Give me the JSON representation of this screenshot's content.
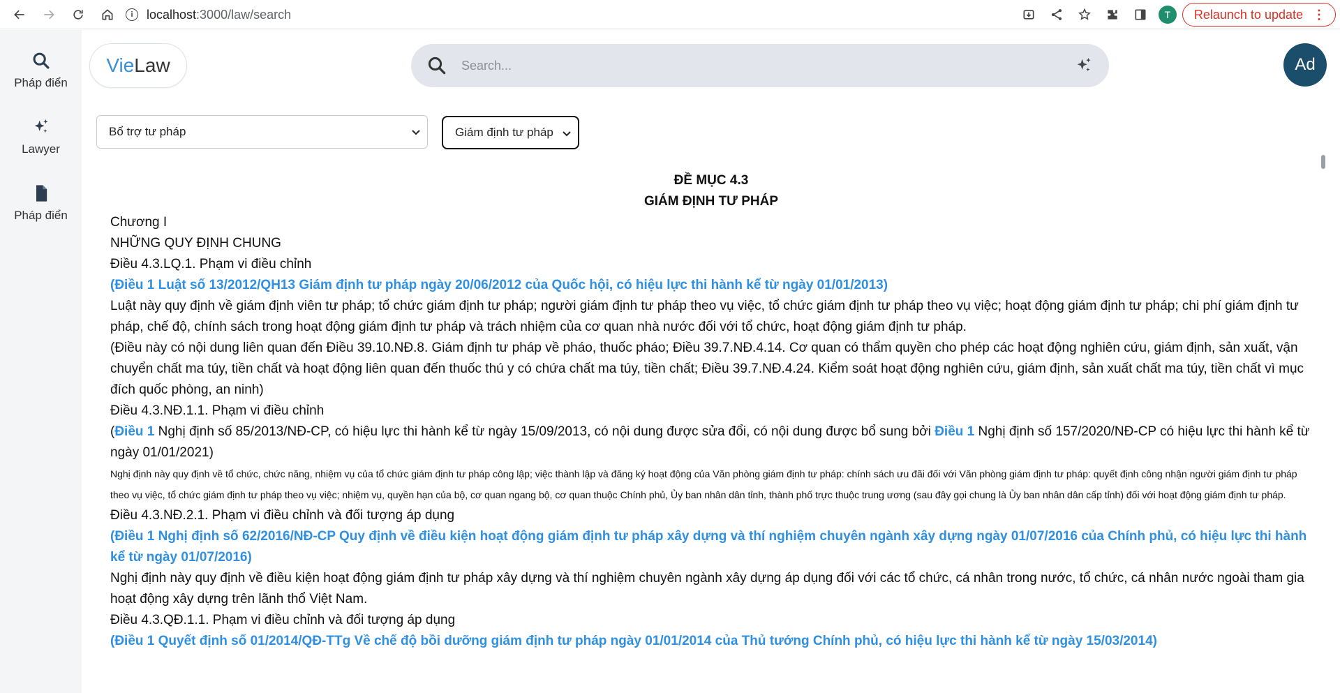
{
  "browser": {
    "url_host": "localhost",
    "url_path": ":3000/law/search",
    "profile_initial": "T",
    "relaunch_label": "Relaunch to update",
    "relaunch_menu": "⋮"
  },
  "sidebar": {
    "items": [
      {
        "label": "Pháp điển",
        "icon": "search-icon"
      },
      {
        "label": "Lawyer",
        "icon": "sparkle-icon"
      },
      {
        "label": "Pháp điển",
        "icon": "document-icon"
      }
    ]
  },
  "header": {
    "logo_vie": "Vie",
    "logo_law": "Law",
    "search_placeholder": "Search...",
    "avatar_initials": "Ad"
  },
  "filters": {
    "topic_selected": "Bổ trợ tư pháp",
    "section_selected": "Giám định tư pháp"
  },
  "document": {
    "heading_1": "ĐỀ MỤC 4.3",
    "heading_2": "GIÁM ĐỊNH TƯ PHÁP",
    "chapter": "Chương I",
    "chapter_title": "NHỮNG QUY ĐỊNH CHUNG",
    "art1_title": "Điều 4.3.LQ.1. Phạm vi điều chỉnh",
    "art1_source": "(Điều 1 Luật số 13/2012/QH13 Giám định tư pháp ngày 20/06/2012 của Quốc hội, có hiệu lực thi hành kể từ ngày 01/01/2013)",
    "art1_body": "Luật này quy định về giám định viên tư pháp; tổ chức giám định tư pháp; người giám định tư pháp theo vụ việc, tổ chức giám định tư pháp theo vụ việc; hoạt động giám định tư pháp; chi phí giám định tư pháp, chế độ, chính sách trong hoạt động giám định tư pháp và trách nhiệm của cơ quan nhà nước đối với tổ chức, hoạt động giám định tư pháp.",
    "art1_related": "(Điều này có nội dung liên quan đến Điều 39.10.NĐ.8. Giám định tư pháp về pháo, thuốc pháo; Điều 39.7.NĐ.4.14. Cơ quan có thẩm quyền cho phép các hoạt động nghiên cứu, giám định, sản xuất, vận chuyển chất ma túy, tiền chất và hoạt động liên quan đến thuốc thú y có chứa chất ma túy, tiền chất; Điều 39.7.NĐ.4.24. Kiểm soát hoạt động nghiên cứu, giám định, sản xuất chất ma túy, tiền chất vì mục đích quốc phòng, an ninh)",
    "art2_title": "Điều 4.3.NĐ.1.1. Phạm vi điều chỉnh",
    "art2_src_open": "(",
    "art2_src_link1": "Điều 1",
    "art2_src_text1": " Nghị định số 85/2013/NĐ-CP, có hiệu lực thi hành kể từ ngày 15/09/2013, có nội dung được sửa đổi, có nội dung được bổ sung bởi ",
    "art2_src_link2": "Điều 1",
    "art2_src_text2": " Nghị định số 157/2020/NĐ-CP có hiệu lực thi hành kể từ ngày 01/01/2021)",
    "art2_body": "Nghị định này quy định về tổ chức, chức năng, nhiệm vụ của tổ chức giám định tư pháp công lập; việc thành lập và đăng ký hoạt động của Văn phòng giám định tư pháp: chính sách ưu đãi đối với Văn phòng giám định tư pháp: quyết định công nhận người giám định tư pháp theo vụ việc, tổ chức giám định tư pháp theo vụ việc; nhiệm vụ, quyền hạn của bộ, cơ quan ngang bộ, cơ quan thuộc Chính phủ, Ủy ban nhân dân tỉnh, thành phố trực thuộc trung ương (sau đây gọi chung là Ủy ban nhân dân cấp tỉnh) đối với hoạt động giám định tư pháp.",
    "art3_title": "Điều 4.3.NĐ.2.1. Phạm vi điều chỉnh và đối tượng áp dụng",
    "art3_source": "(Điều 1 Nghị định số 62/2016/NĐ-CP Quy định về điều kiện hoạt động giám định tư pháp xây dựng và thí nghiệm chuyên ngành xây dựng ngày 01/07/2016 của Chính phủ, có hiệu lực thi hành kể từ ngày 01/07/2016)",
    "art3_body": "Nghị định này quy định về điều kiện hoạt động giám định tư pháp xây dựng và thí nghiệm chuyên ngành xây dựng áp dụng đối với các tổ chức, cá nhân trong nước, tổ chức, cá nhân nước ngoài tham gia hoạt động xây dựng trên lãnh thổ Việt Nam.",
    "art4_title": "Điều 4.3.QĐ.1.1. Phạm vi điều chỉnh và đối tượng áp dụng",
    "art4_source": "(Điều 1 Quyết định số 01/2014/QĐ-TTg Về chế độ bồi dưỡng giám định tư pháp ngày 01/01/2014 của Thủ tướng Chính phủ, có hiệu lực thi hành kể từ ngày 15/03/2014)"
  }
}
